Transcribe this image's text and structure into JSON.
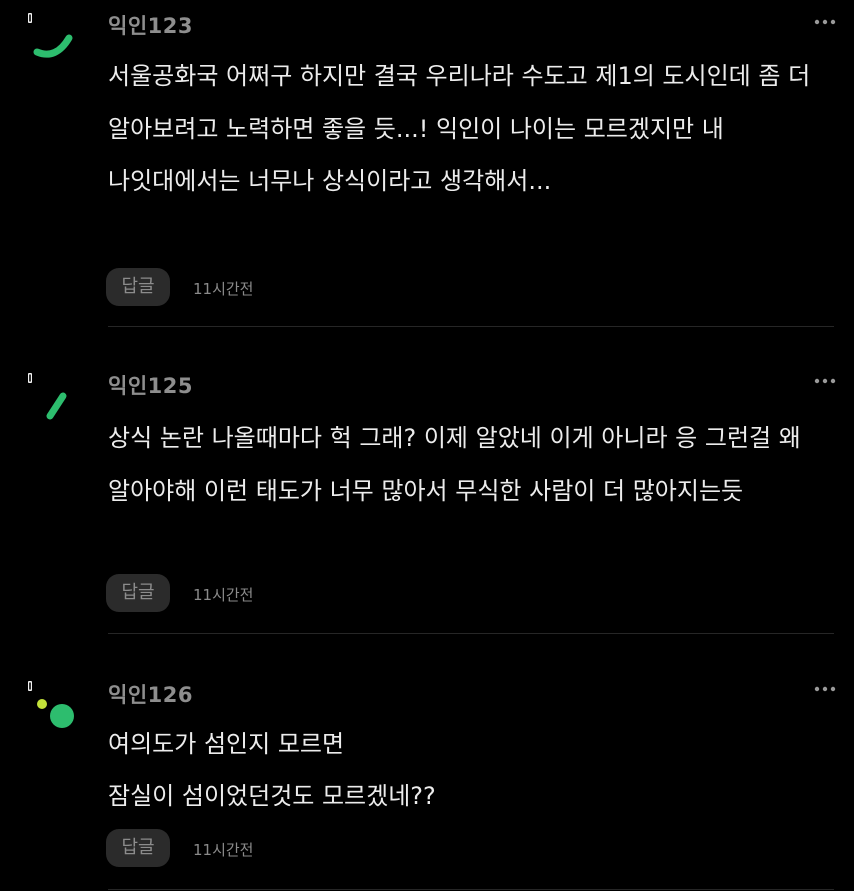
{
  "comments": [
    {
      "nickname": "익인123",
      "text": "서울공화국 어쩌구 하지만 결국 우리나라 수도고 제1의 도시인데 좀 더 알아보려고 노력하면 좋을 듯...! 익인이 나이는 모르겠지만 내 나잇대에서는 너무나 상식이라고 생각해서...",
      "reply_label": "답글",
      "time": "11시간전",
      "avatar_icon": "green-arc-icon"
    },
    {
      "nickname": "익인125",
      "text": "상식 논란 나올때마다 헉 그래? 이제 알았네 이게 아니라 응 그런걸 왜 알아야해 이런 태도가 너무 많아서 무식한 사람이 더 많아지는듯",
      "reply_label": "답글",
      "time": "11시간전",
      "avatar_icon": "green-slash-icon"
    },
    {
      "nickname": "익인126",
      "text": "여의도가 섬인지 모르면\n잠실이 섬이었던것도 모르겠네??",
      "reply_label": "답글",
      "time": "11시간전",
      "avatar_icon": "green-dots-icon"
    }
  ],
  "more_icon": "more-horizontal-icon",
  "colors": {
    "background": "#000000",
    "accent_green": "#2dbd6e",
    "accent_lime": "#c3e23a",
    "text_primary": "#ececec",
    "text_secondary": "#8e8e8e"
  }
}
